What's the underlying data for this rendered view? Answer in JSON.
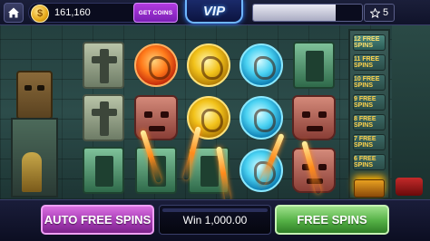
{
  "topbar": {
    "coin_balance": "161,160",
    "get_coins_label": "GET COINS",
    "vip_label": "VIP",
    "xp_progress": 0.76,
    "level": "5"
  },
  "right_tower": {
    "tiers": [
      "12 FREE SPINS",
      "11 FREE SPINS",
      "10 FREE SPINS",
      "9 FREE SPINS",
      "8 FREE SPINS",
      "7 FREE SPINS",
      "6 FREE SPINS"
    ]
  },
  "reels": [
    [
      "ankh-totem",
      "ankh-totem",
      "green-totem"
    ],
    [
      "fire-orb",
      "red-mask",
      "green-totem"
    ],
    [
      "gold-orb",
      "gold-orb",
      "green-totem"
    ],
    [
      "ice-orb",
      "ice-orb",
      "ice-orb"
    ],
    [
      "green-totem",
      "red-mask",
      "red-mask"
    ]
  ],
  "bottombar": {
    "auto_spins_label": "AUTO FREE SPINS",
    "win_text": "Win 1,000.00",
    "free_spins_label": "FREE SPINS"
  },
  "colors": {
    "auto_button": "#a63bb5",
    "free_button": "#54b045",
    "coin_gold": "#e6a818"
  }
}
